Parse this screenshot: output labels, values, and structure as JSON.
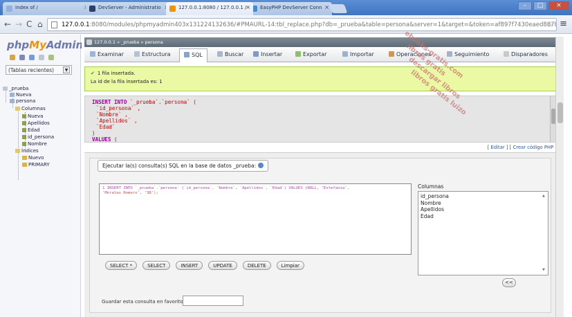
{
  "browser": {
    "tabs": [
      {
        "label": "Index of /",
        "favicon": "folder-favicon"
      },
      {
        "label": "DevServer - Administratio",
        "favicon": "devserver-favicon"
      },
      {
        "label": "127.0.0.1:8080 / 127.0.0.1 /",
        "favicon": "phpmyadmin-favicon"
      },
      {
        "label": "EasyPHP DevServer Conn",
        "favicon": "easyphp-favicon"
      }
    ],
    "url_host": "127.0.0.1",
    "url_path": ":8080/modules/phpmyadmin403x131224132636/#PMAURL-14:tbl_replace.php?db=_prueba&table=persona&server=1&target=&token=af897f7430eaed887b"
  },
  "sidebar": {
    "logo_php": "php",
    "logo_my": "My",
    "logo_admin": "Admin",
    "recent": "(Tablas recientes)",
    "tree": {
      "db": "_prueba",
      "new1": "Nueva",
      "table": "persona",
      "columns": "Columnas",
      "new2": "Nueva",
      "col1": "Apellidos",
      "col2": "Edad",
      "col3": "id_persona",
      "col4": "Nombre",
      "indexes": "Índices",
      "new3": "Nuevo",
      "idx1": "PRIMARY"
    }
  },
  "breadcrumb": {
    "server": "127.0.0.1",
    "db": "_prueba",
    "table": "persona"
  },
  "tabs": [
    {
      "label": "Examinar",
      "icon": "browse-icon"
    },
    {
      "label": "Estructura",
      "icon": "structure-icon"
    },
    {
      "label": "SQL",
      "icon": "sql-icon",
      "active": true
    },
    {
      "label": "Buscar",
      "icon": "search-icon"
    },
    {
      "label": "Insertar",
      "icon": "insert-icon"
    },
    {
      "label": "Exportar",
      "icon": "export-icon"
    },
    {
      "label": "Importar",
      "icon": "import-icon"
    },
    {
      "label": "Operaciones",
      "icon": "wrench-icon"
    },
    {
      "label": "Seguimiento",
      "icon": "tracking-icon"
    },
    {
      "label": "Disparadores",
      "icon": "triggers-icon"
    }
  ],
  "message": {
    "line1": "1 fila insertada.",
    "line2": "La id de la fila insertada es: 1"
  },
  "sql_display": {
    "l1_kw": "INSERT INTO",
    "l1_rest": " `_prueba`.`persona` (",
    "l2": "`id_persona` ,",
    "l3": "`Nombre` ,",
    "l4": "`Apellidos` ,",
    "l5": "`Edad`",
    "l6": ")",
    "l7_kw": "VALUES",
    "l7_rest": " ("
  },
  "edit_links": "[ Editar ] [ Crear código PHP ]",
  "query_panel": {
    "legend": "Ejecutar la(s) consulta(s) SQL en la base de datos _prueba:",
    "textarea_line1": "1 INSERT INTO `_prueba`.`persona` (`id_persona`, `Nombre`, `Apellidos`, `Edad`) VALUES (NULL, 'Estefania',",
    "textarea_line2": "'Morales Romero', '38');",
    "buttons": [
      "SELECT *",
      "SELECT",
      "INSERT",
      "UPDATE",
      "DELETE",
      "Limpiar"
    ],
    "columns_label": "Columnas",
    "columns": [
      "id_persona",
      "Nombre",
      "Apellidos",
      "Edad"
    ],
    "insert_btn": "<<",
    "fav_label": "Guardar esta consulta en favoritos:"
  },
  "watermark": [
    "ebooks-gratis.com",
    "libros gratis",
    "descargar libros",
    "libros gratis luizo"
  ],
  "colors": {
    "success_bg": "#ebf8a4",
    "success_border": "#a2d246",
    "sql_keyword": "#990099",
    "pma_blue": "#6c78af",
    "pma_orange": "#f29400"
  }
}
